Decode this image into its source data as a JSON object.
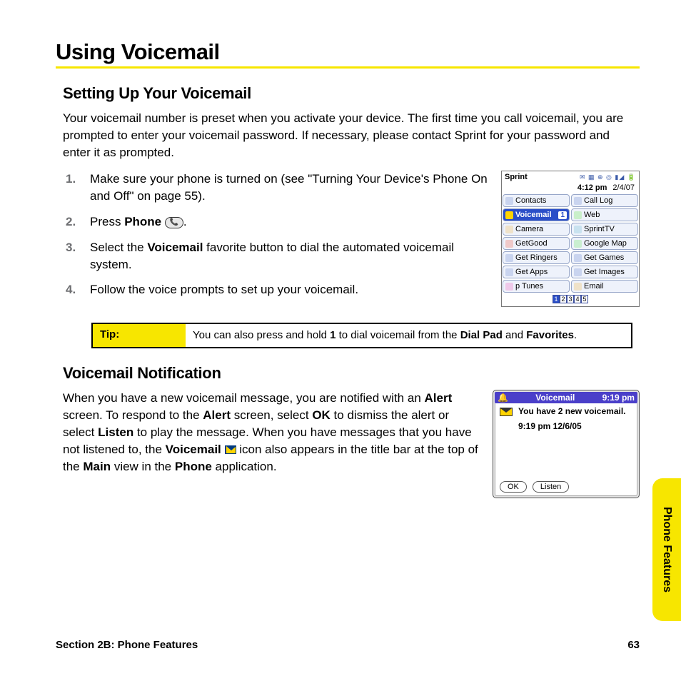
{
  "title": "Using Voicemail",
  "section1": {
    "heading": "Setting Up Your Voicemail",
    "intro": "Your voicemail number is preset when you activate your device. The first time you call voicemail, you are prompted to enter your voicemail password. If necessary, please contact Sprint for your password and enter it as prompted.",
    "steps": {
      "s1a": "Make sure your phone is turned on (see \"Turning Your Device's Phone On and Off\" on page 55).",
      "s2a": "Press ",
      "s2b": "Phone",
      "s2c": " ",
      "s2d": ".",
      "s3a": "Select the ",
      "s3b": "Voicemail",
      "s3c": " favorite button to dial the automated voicemail system.",
      "s4a": "Follow the voice prompts to set up your voicemail."
    }
  },
  "device1": {
    "carrier": "Sprint",
    "time": "4:12 pm",
    "date": "2/4/07",
    "voicemail_badge": "1",
    "favs": {
      "contacts": "Contacts",
      "calllog": "Call Log",
      "voicemail": "Voicemail",
      "web": "Web",
      "camera": "Camera",
      "sprinttv": "SprintTV",
      "getgood": "GetGood",
      "googlemap": "Google Map",
      "getringers": "Get Ringers",
      "getgames": "Get Games",
      "getapps": "Get Apps",
      "getimages": "Get Images",
      "ptunes": "p Tunes",
      "email": "Email"
    },
    "pages": [
      "1",
      "2",
      "3",
      "4",
      "5"
    ]
  },
  "tip": {
    "label": "Tip:",
    "t1": "You can also press and hold ",
    "t2": "1",
    "t3": " to dial voicemail from the ",
    "t4": "Dial Pad",
    "t5": " and ",
    "t6": "Favorites",
    "t7": "."
  },
  "section2": {
    "heading": "Voicemail Notification",
    "p1": "When you have a new voicemail message, you are notified with an ",
    "p2": "Alert",
    "p3": " screen. To respond to the ",
    "p4": "Alert",
    "p5": " screen, select ",
    "p6": "OK",
    "p7": " to dismiss the alert or select ",
    "p8": "Listen",
    "p9": " to play the message. When you have messages that you have not listened to, the ",
    "p10": "Voicemail",
    "p11": " ",
    "p12": " icon also appears in the title bar at the top of the ",
    "p13": "Main",
    "p14": " view in the ",
    "p15": "Phone",
    "p16": " application."
  },
  "device2": {
    "title": "Voicemail",
    "title_time": "9:19 pm",
    "msg": "You have 2 new voicemail.",
    "ts": "9:19 pm 12/6/05",
    "ok": "OK",
    "listen": "Listen"
  },
  "footer": {
    "section": "Section 2B: Phone Features",
    "page": "63"
  },
  "sidetab": "Phone Features"
}
